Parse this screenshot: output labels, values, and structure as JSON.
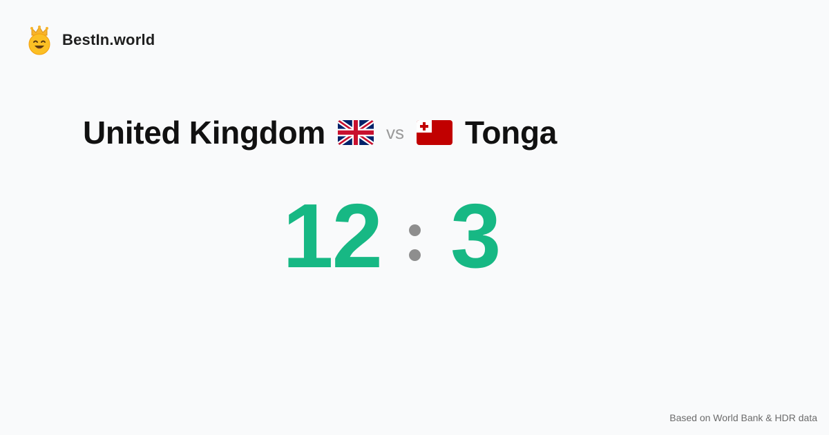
{
  "brand": {
    "name": "BestIn.world",
    "logo_icon": "crown-smiley-icon"
  },
  "matchup": {
    "left_country": "United Kingdom",
    "left_flag_icon": "uk-flag-icon",
    "vs_label": "vs",
    "right_country": "Tonga",
    "right_flag_icon": "tonga-flag-icon"
  },
  "score": {
    "left": "12",
    "right": "3",
    "color": "#17b884",
    "separator_color": "#8e8e8e"
  },
  "footer": {
    "source_note": "Based on World Bank & HDR data"
  },
  "colors": {
    "background": "#f9fafb",
    "text": "#111111",
    "muted": "#9a9a9a"
  }
}
